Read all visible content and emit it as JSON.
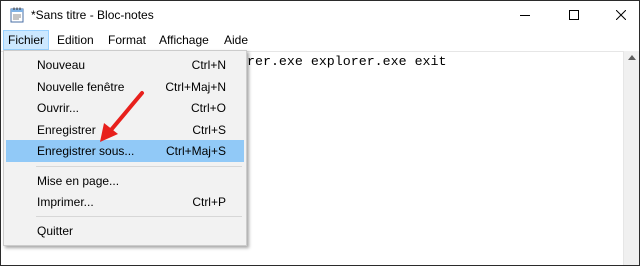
{
  "window": {
    "title": "*Sans titre - Bloc-notes",
    "controls": {
      "minimize_icon": "minimize-icon",
      "maximize_icon": "maximize-icon",
      "close_icon": "close-icon"
    }
  },
  "menubar": {
    "items": [
      {
        "label": "Fichier"
      },
      {
        "label": "Edition"
      },
      {
        "label": "Format"
      },
      {
        "label": "Affichage"
      },
      {
        "label": "Aide"
      }
    ]
  },
  "editor": {
    "text": "rer.exe explorer.exe exit"
  },
  "file_menu": {
    "items": [
      {
        "label": "Nouveau",
        "shortcut": "Ctrl+N"
      },
      {
        "label": "Nouvelle fenêtre",
        "shortcut": "Ctrl+Maj+N"
      },
      {
        "label": "Ouvrir...",
        "shortcut": "Ctrl+O"
      },
      {
        "label": "Enregistrer",
        "shortcut": "Ctrl+S"
      },
      {
        "label": "Enregistrer sous...",
        "shortcut": "Ctrl+Maj+S"
      },
      {
        "label": "Mise en page...",
        "shortcut": ""
      },
      {
        "label": "Imprimer...",
        "shortcut": "Ctrl+P"
      },
      {
        "label": "Quitter",
        "shortcut": ""
      }
    ],
    "highlighted": "Enregistrer sous..."
  },
  "colors": {
    "highlight": "#91c9f7",
    "menu_active": "#cce8ff",
    "annotation_arrow": "#e8201c"
  }
}
